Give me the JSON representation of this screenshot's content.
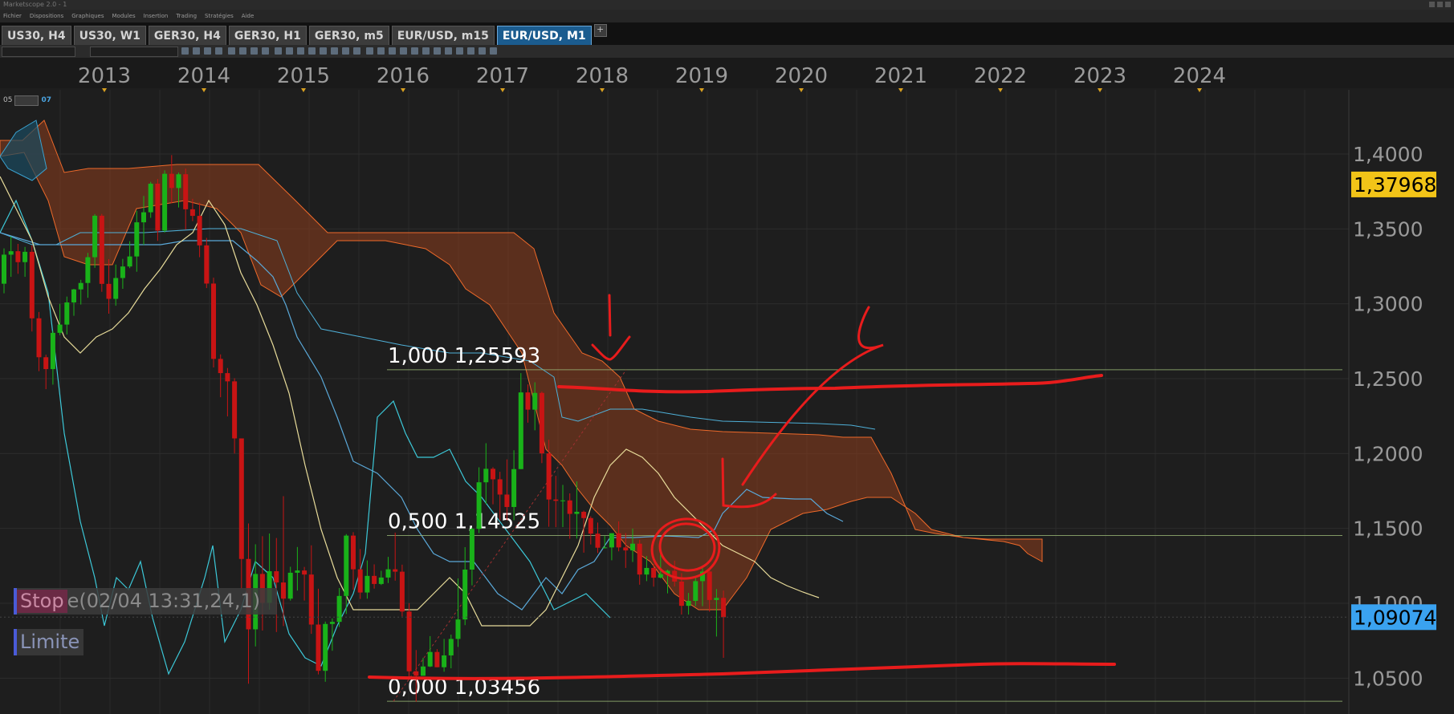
{
  "window": {
    "title": "Marketscope 2.0 - 1"
  },
  "menu": [
    "Fichier",
    "Dispositions",
    "Graphiques",
    "Modules",
    "Insertion",
    "Trading",
    "Stratégies",
    "Aide"
  ],
  "tabs": [
    {
      "label": "US30, H4",
      "active": false
    },
    {
      "label": "US30, W1",
      "active": false
    },
    {
      "label": "GER30, H4",
      "active": false
    },
    {
      "label": "GER30, H1",
      "active": false
    },
    {
      "label": "GER30, m5",
      "active": false
    },
    {
      "label": "EUR/USD, m15",
      "active": false
    },
    {
      "label": "EUR/USD, M1",
      "active": true
    }
  ],
  "indicator_legend": {
    "left": "05",
    "right": "07"
  },
  "chart_data": {
    "type": "candlestick",
    "x_axis": {
      "ticks": [
        "2013",
        "2014",
        "2015",
        "2016",
        "2017",
        "2018",
        "2019",
        "2020",
        "2021",
        "2022",
        "2023",
        "2024"
      ]
    },
    "y_axis": {
      "ticks": [
        "1,0500",
        "1,1000",
        "1,1500",
        "1,2000",
        "1,2500",
        "1,3000",
        "1,3500",
        "1,4000"
      ],
      "range": [
        1.033,
        1.44
      ]
    },
    "current_price": "1,09074",
    "marker_price": "1,37968",
    "fibonacci": [
      {
        "label": "1,000 1,25593",
        "value": 1.25593
      },
      {
        "label": "0,500 1,14525",
        "value": 1.14525
      },
      {
        "label": "0,000 1,03456",
        "value": 1.03456
      }
    ],
    "candles": [
      {
        "o": 1.3134,
        "c": 1.3328,
        "h": 1.337,
        "l": 1.307
      },
      {
        "o": 1.3328,
        "c": 1.3351,
        "h": 1.345,
        "l": 1.318
      },
      {
        "o": 1.3351,
        "c": 1.3278,
        "h": 1.34,
        "l": 1.32
      },
      {
        "o": 1.3278,
        "c": 1.3347,
        "h": 1.338,
        "l": 1.318
      },
      {
        "o": 1.3347,
        "c": 1.2903,
        "h": 1.339,
        "l": 1.2815
      },
      {
        "o": 1.2903,
        "c": 1.2643,
        "h": 1.2945,
        "l": 1.255
      },
      {
        "o": 1.2643,
        "c": 1.2564,
        "h": 1.266,
        "l": 1.243
      },
      {
        "o": 1.2564,
        "c": 1.2806,
        "h": 1.282,
        "l": 1.246
      },
      {
        "o": 1.2806,
        "c": 1.2861,
        "h": 1.3,
        "l": 1.279
      },
      {
        "o": 1.2861,
        "c": 1.3009,
        "h": 1.3048,
        "l": 1.2795
      },
      {
        "o": 1.3009,
        "c": 1.3096,
        "h": 1.31,
        "l": 1.292
      },
      {
        "o": 1.3096,
        "c": 1.3139,
        "h": 1.316,
        "l": 1.2995
      },
      {
        "o": 1.3139,
        "c": 1.3311,
        "h": 1.334,
        "l": 1.304
      },
      {
        "o": 1.3311,
        "c": 1.3588,
        "h": 1.3599,
        "l": 1.324
      },
      {
        "o": 1.3588,
        "c": 1.3133,
        "h": 1.36,
        "l": 1.308
      },
      {
        "o": 1.3133,
        "c": 1.3033,
        "h": 1.3298,
        "l": 1.2934
      },
      {
        "o": 1.3033,
        "c": 1.3172,
        "h": 1.3262,
        "l": 1.2987
      },
      {
        "o": 1.3172,
        "c": 1.3249,
        "h": 1.33,
        "l": 1.31
      },
      {
        "o": 1.3249,
        "c": 1.3316,
        "h": 1.3418,
        "l": 1.3238
      },
      {
        "o": 1.3316,
        "c": 1.3544,
        "h": 1.3621,
        "l": 1.3214
      },
      {
        "o": 1.3544,
        "c": 1.3611,
        "h": 1.372,
        "l": 1.3393
      },
      {
        "o": 1.3611,
        "c": 1.3802,
        "h": 1.3814,
        "l": 1.3574
      },
      {
        "o": 1.3802,
        "c": 1.3489,
        "h": 1.3833,
        "l": 1.342
      },
      {
        "o": 1.3489,
        "c": 1.3868,
        "h": 1.3891,
        "l": 1.3475
      },
      {
        "o": 1.3868,
        "c": 1.3773,
        "h": 1.3993,
        "l": 1.3671
      },
      {
        "o": 1.3773,
        "c": 1.3865,
        "h": 1.3876,
        "l": 1.3643
      },
      {
        "o": 1.3865,
        "c": 1.3631,
        "h": 1.3903,
        "l": 1.3496
      },
      {
        "o": 1.3631,
        "c": 1.3587,
        "h": 1.3701,
        "l": 1.3552
      },
      {
        "o": 1.3587,
        "c": 1.339,
        "h": 1.3676,
        "l": 1.3311
      },
      {
        "o": 1.339,
        "c": 1.3135,
        "h": 1.344,
        "l": 1.3105
      },
      {
        "o": 1.3135,
        "c": 1.2632,
        "h": 1.3174,
        "l": 1.2575
      },
      {
        "o": 1.2632,
        "c": 1.2537,
        "h": 1.2662,
        "l": 1.2376
      },
      {
        "o": 1.2537,
        "c": 1.2482,
        "h": 1.2571,
        "l": 1.2248
      },
      {
        "o": 1.2482,
        "c": 1.2101,
        "h": 1.2503,
        "l": 1.2
      },
      {
        "o": 1.2101,
        "c": 1.1296,
        "h": 1.2099,
        "l": 1.1098
      },
      {
        "o": 1.1296,
        "c": 1.0826,
        "h": 1.1533,
        "l": 1.0463
      },
      {
        "o": 1.0826,
        "c": 1.1196,
        "h": 1.1394,
        "l": 1.0712
      },
      {
        "o": 1.1196,
        "c": 1.1003,
        "h": 1.1448,
        "l": 1.0818
      },
      {
        "o": 1.1003,
        "c": 1.1214,
        "h": 1.1466,
        "l": 1.0957
      },
      {
        "o": 1.1214,
        "c": 1.1139,
        "h": 1.1436,
        "l": 1.0808
      },
      {
        "o": 1.1139,
        "c": 1.1031,
        "h": 1.1715,
        "l": 1.0848
      },
      {
        "o": 1.1031,
        "c": 1.1204,
        "h": 1.1244,
        "l": 1.1018
      },
      {
        "o": 1.1204,
        "c": 1.1219,
        "h": 1.1376,
        "l": 1.1085
      },
      {
        "o": 1.1219,
        "c": 1.1192,
        "h": 1.1243,
        "l": 1.1018
      },
      {
        "o": 1.1192,
        "c": 1.0858,
        "h": 1.1387,
        "l": 1.0796
      },
      {
        "o": 1.0858,
        "c": 1.0549,
        "h": 1.1097,
        "l": 1.0525
      },
      {
        "o": 1.0549,
        "c": 1.0862,
        "h": 1.0878,
        "l": 1.0476
      },
      {
        "o": 1.0862,
        "c": 1.0876,
        "h": 1.0899,
        "l": 1.0683
      },
      {
        "o": 1.0876,
        "c": 1.1049,
        "h": 1.1102,
        "l": 1.0842
      },
      {
        "o": 1.1049,
        "c": 1.1452,
        "h": 1.1462,
        "l": 1.0929
      },
      {
        "o": 1.1452,
        "c": 1.1227,
        "h": 1.1475,
        "l": 1.1091
      },
      {
        "o": 1.1227,
        "c": 1.1072,
        "h": 1.1362,
        "l": 1.1029
      },
      {
        "o": 1.1072,
        "c": 1.1183,
        "h": 1.1286,
        "l": 1.1031
      },
      {
        "o": 1.1183,
        "c": 1.1129,
        "h": 1.126,
        "l": 1.1098
      },
      {
        "o": 1.1129,
        "c": 1.1172,
        "h": 1.1217,
        "l": 1.1122
      },
      {
        "o": 1.1172,
        "c": 1.1227,
        "h": 1.131,
        "l": 1.1135
      },
      {
        "o": 1.1227,
        "c": 1.1211,
        "h": 1.1472,
        "l": 1.1151
      },
      {
        "o": 1.1211,
        "c": 1.0945,
        "h": 1.1258,
        "l": 1.0912
      },
      {
        "o": 1.0945,
        "c": 1.0546,
        "h": 1.1001,
        "l": 1.0506
      },
      {
        "o": 1.0546,
        "c": 1.0516,
        "h": 1.0688,
        "l": 1.0343
      },
      {
        "o": 1.0516,
        "c": 1.0578,
        "h": 1.0636,
        "l": 1.0529
      },
      {
        "o": 1.0578,
        "c": 1.0675,
        "h": 1.0781,
        "l": 1.0574
      },
      {
        "o": 1.0675,
        "c": 1.0573,
        "h": 1.0694,
        "l": 1.0573
      },
      {
        "o": 1.0573,
        "c": 1.0652,
        "h": 1.0762,
        "l": 1.0543
      },
      {
        "o": 1.0652,
        "c": 1.0762,
        "h": 1.0791,
        "l": 1.0566
      },
      {
        "o": 1.0762,
        "c": 1.0892,
        "h": 1.1166,
        "l": 1.0709
      },
      {
        "o": 1.0892,
        "c": 1.1225,
        "h": 1.1375,
        "l": 1.0854
      },
      {
        "o": 1.1225,
        "c": 1.1497,
        "h": 1.1506,
        "l": 1.112
      },
      {
        "o": 1.1497,
        "c": 1.1808,
        "h": 1.1908,
        "l": 1.1469
      },
      {
        "o": 1.1808,
        "c": 1.1898,
        "h": 1.2069,
        "l": 1.1663
      },
      {
        "o": 1.1898,
        "c": 1.1828,
        "h": 1.1909,
        "l": 1.1661
      },
      {
        "o": 1.1828,
        "c": 1.1726,
        "h": 1.1878,
        "l": 1.1553
      },
      {
        "o": 1.1726,
        "c": 1.1643,
        "h": 1.1961,
        "l": 1.1554
      },
      {
        "o": 1.1643,
        "c": 1.1896,
        "h": 1.2022,
        "l": 1.1555
      },
      {
        "o": 1.1896,
        "c": 1.2408,
        "h": 1.2537,
        "l": 1.1917
      },
      {
        "o": 1.2408,
        "c": 1.2293,
        "h": 1.2462,
        "l": 1.2206
      },
      {
        "o": 1.2293,
        "c": 1.2405,
        "h": 1.2476,
        "l": 1.2155
      },
      {
        "o": 1.2405,
        "c": 1.2001,
        "h": 1.2414,
        "l": 1.1936
      },
      {
        "o": 1.2001,
        "c": 1.1693,
        "h": 1.2092,
        "l": 1.1511
      },
      {
        "o": 1.1693,
        "c": 1.1684,
        "h": 1.1851,
        "l": 1.1508
      },
      {
        "o": 1.1684,
        "c": 1.1687,
        "h": 1.1791,
        "l": 1.1509
      },
      {
        "o": 1.1687,
        "c": 1.1597,
        "h": 1.1734,
        "l": 1.1431
      },
      {
        "o": 1.1597,
        "c": 1.1611,
        "h": 1.1814,
        "l": 1.1432
      },
      {
        "o": 1.1611,
        "c": 1.1569,
        "h": 1.1619,
        "l": 1.1338
      },
      {
        "o": 1.1569,
        "c": 1.1465,
        "h": 1.1581,
        "l": 1.1393
      },
      {
        "o": 1.1465,
        "c": 1.1371,
        "h": 1.1539,
        "l": 1.1336
      },
      {
        "o": 1.1371,
        "c": 1.1373,
        "h": 1.1451,
        "l": 1.1366
      },
      {
        "o": 1.1373,
        "c": 1.1468,
        "h": 1.1455,
        "l": 1.1287
      },
      {
        "o": 1.1468,
        "c": 1.1373,
        "h": 1.1547,
        "l": 1.1347
      },
      {
        "o": 1.1373,
        "c": 1.1353,
        "h": 1.1469,
        "l": 1.1236
      },
      {
        "o": 1.1353,
        "c": 1.1398,
        "h": 1.1499,
        "l": 1.1276
      },
      {
        "o": 1.1398,
        "c": 1.1192,
        "h": 1.1424,
        "l": 1.1124
      },
      {
        "o": 1.1192,
        "c": 1.1236,
        "h": 1.1315,
        "l": 1.1148
      },
      {
        "o": 1.1236,
        "c": 1.1171,
        "h": 1.1262,
        "l": 1.1111
      },
      {
        "o": 1.1171,
        "c": 1.1195,
        "h": 1.1356,
        "l": 1.1166
      },
      {
        "o": 1.1195,
        "c": 1.1217,
        "h": 1.1225,
        "l": 1.1066
      },
      {
        "o": 1.1217,
        "c": 1.1145,
        "h": 1.1285,
        "l": 1.1112
      },
      {
        "o": 1.1145,
        "c": 1.0983,
        "h": 1.1201,
        "l": 1.0925
      },
      {
        "o": 1.0983,
        "c": 1.1016,
        "h": 1.1069,
        "l": 1.0925
      },
      {
        "o": 1.1016,
        "c": 1.1148,
        "h": 1.1178,
        "l": 1.0981
      },
      {
        "o": 1.1148,
        "c": 1.1212,
        "h": 1.1239,
        "l": 1.0981
      },
      {
        "o": 1.1212,
        "c": 1.1022,
        "h": 1.1239,
        "l": 1.0944
      },
      {
        "o": 1.1022,
        "c": 1.1036,
        "h": 1.1095,
        "l": 1.0778
      },
      {
        "o": 1.1036,
        "c": 1.0907,
        "h": 1.1085,
        "l": 1.0636
      }
    ]
  },
  "order_buttons": {
    "stop_label": "Stop",
    "stop_sub": "e(02/04 13:31,24,1)",
    "limit_label": "Limite"
  },
  "colors": {
    "bull": "#19b219",
    "bear": "#c81414",
    "cloud": "#8e3e1d",
    "current_price_bg": "#3aa2f0",
    "marker_price_bg": "#f2c418",
    "annotation": "#e81c1c",
    "fib_line": "#9ab877"
  }
}
